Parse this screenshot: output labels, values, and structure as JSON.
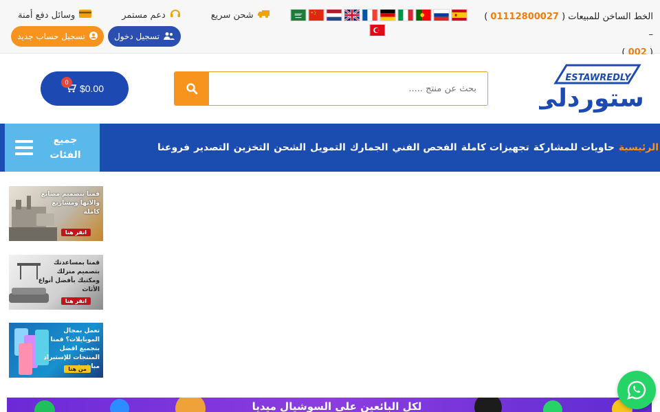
{
  "topbar": {
    "hotline_label": "الخط الساخن للمبيعات (",
    "hotline_number": "01112800027",
    "hotline_sep": ") –",
    "hotline_code": "002",
    "features": [
      {
        "label": "شحن سريع",
        "icon": "truck-icon"
      },
      {
        "label": "دعم مستمر",
        "icon": "headset-icon"
      },
      {
        "label": "وسائل دفع أمنة",
        "icon": "credit-card-icon"
      }
    ],
    "auth": {
      "login_label": "تسجيل دخول",
      "register_label": "تسجيل حساب جديد"
    },
    "flags": [
      "saudi-arabia",
      "china",
      "netherlands",
      "united-kingdom",
      "france",
      "germany",
      "italy",
      "portugal",
      "russia",
      "spain",
      "turkey"
    ]
  },
  "header": {
    "logo_arabic": "إستوردلى",
    "logo_latin": "ESTAWREDLY",
    "search": {
      "placeholder": "بحث عن منتج ....."
    },
    "cart": {
      "total": "$0.00",
      "count": "0"
    }
  },
  "nav": {
    "categories_label": "جميع الفئات",
    "items": [
      "الرئيسية",
      "حاويات للمشاركة",
      "تجهيزات كاملة",
      "الفحص الفني",
      "الجمارك",
      "التمويل",
      "الشحن",
      "التخزين",
      "التصدير",
      "فروعنا"
    ]
  },
  "banners": [
    {
      "text": "قمنا بتصميم مصانع والاتها ومشاريع كاملة",
      "cta": "انقر هنا"
    },
    {
      "text": "قمنا بمساعدتك بتصميم منزلك ومكتبك بأفضل أنواع الأثاث",
      "cta": "انقر هنا"
    },
    {
      "text": "تعمل بمجال الموبايلات؟ قمنا بتجميع افضل المنتجات للإستيراد مباشرة",
      "cta": "من هنا"
    }
  ],
  "bottom_banner": {
    "text": "لكل البائعين على السوشيال ميديا"
  },
  "colors": {
    "primary": "#1b4db1",
    "accent": "#f7941d",
    "nav_categories": "#5bb8ea",
    "whatsapp": "#25d366"
  }
}
